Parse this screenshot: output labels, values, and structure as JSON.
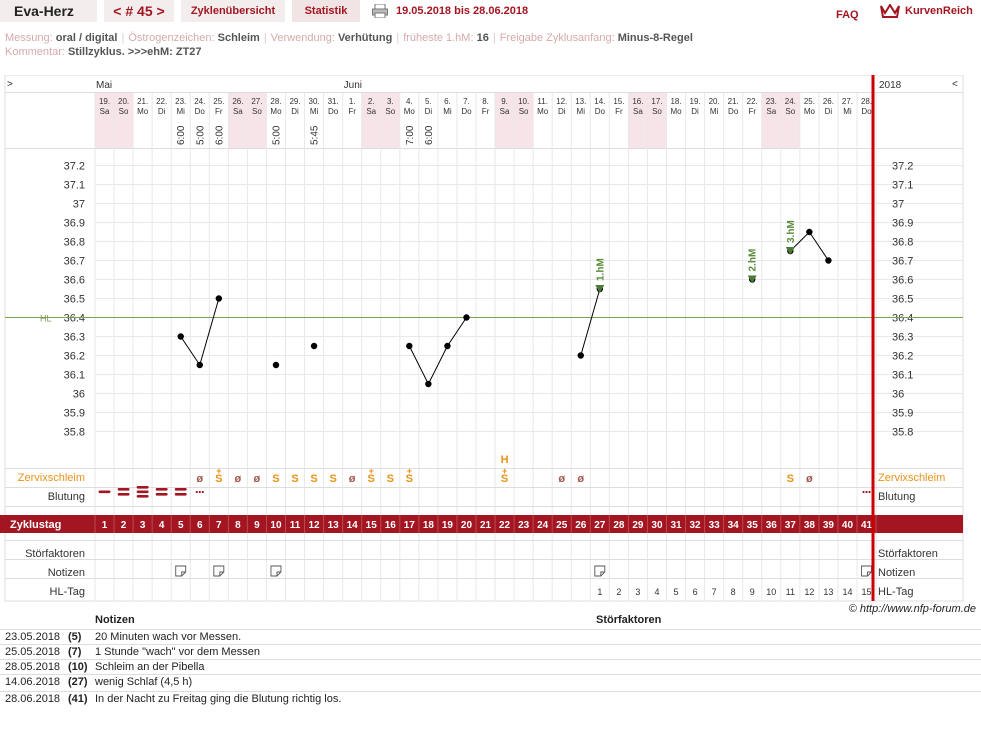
{
  "header": {
    "title": "Eva-Herz",
    "cycle_nav": "< # 45 >",
    "tab_overview": "Zyklenübersicht",
    "tab_stats": "Statistik",
    "range": "19.05.2018 bis 28.06.2018",
    "faq": "FAQ",
    "brand": "KurvenReich"
  },
  "meta": {
    "row1": [
      {
        "label": "Messung:",
        "value": "oral / digital"
      },
      {
        "label": "Östrogenzeichen:",
        "value": "Schleim"
      },
      {
        "label": "Verwendung:",
        "value": "Verhütung"
      },
      {
        "label": "früheste 1.hM:",
        "value": "16"
      },
      {
        "label": "Freigabe Zyklusanfang:",
        "value": "Minus-8-Regel"
      }
    ],
    "row2": [
      {
        "label": "Kommentar:",
        "value": "Stillzyklus.  >>>ehM: ZT27"
      }
    ]
  },
  "colors": {
    "accent": "#a31621",
    "weekend": "#f7e4e8",
    "hl_line": "#7aa34e",
    "mucus": "#e8921a",
    "mucus_dry": "#a2564c",
    "grid": "#e8e8e8"
  },
  "chart_data": {
    "type": "line",
    "months": [
      {
        "label": "Mai",
        "day_index": 0
      },
      {
        "label": "Juni",
        "day_index": 13
      }
    ],
    "year_label": "2018",
    "nav_left": ">",
    "nav_right": "<",
    "days": [
      {
        "d": "19.",
        "w": "Sa"
      },
      {
        "d": "20.",
        "w": "So"
      },
      {
        "d": "21.",
        "w": "Mo"
      },
      {
        "d": "22.",
        "w": "Di"
      },
      {
        "d": "23.",
        "w": "Mi"
      },
      {
        "d": "24.",
        "w": "Do"
      },
      {
        "d": "25.",
        "w": "Fr"
      },
      {
        "d": "26.",
        "w": "Sa"
      },
      {
        "d": "27.",
        "w": "So"
      },
      {
        "d": "28.",
        "w": "Mo"
      },
      {
        "d": "29.",
        "w": "Di"
      },
      {
        "d": "30.",
        "w": "Mi"
      },
      {
        "d": "31.",
        "w": "Do"
      },
      {
        "d": "1.",
        "w": "Fr"
      },
      {
        "d": "2.",
        "w": "Sa"
      },
      {
        "d": "3.",
        "w": "So"
      },
      {
        "d": "4.",
        "w": "Mo"
      },
      {
        "d": "5.",
        "w": "Di"
      },
      {
        "d": "6.",
        "w": "Mi"
      },
      {
        "d": "7.",
        "w": "Do"
      },
      {
        "d": "8.",
        "w": "Fr"
      },
      {
        "d": "9.",
        "w": "Sa"
      },
      {
        "d": "10.",
        "w": "So"
      },
      {
        "d": "11.",
        "w": "Mo"
      },
      {
        "d": "12.",
        "w": "Di"
      },
      {
        "d": "13.",
        "w": "Mi"
      },
      {
        "d": "14.",
        "w": "Do"
      },
      {
        "d": "15.",
        "w": "Fr"
      },
      {
        "d": "16.",
        "w": "Sa"
      },
      {
        "d": "17.",
        "w": "So"
      },
      {
        "d": "18.",
        "w": "Mo"
      },
      {
        "d": "19.",
        "w": "Di"
      },
      {
        "d": "20.",
        "w": "Mi"
      },
      {
        "d": "21.",
        "w": "Do"
      },
      {
        "d": "22.",
        "w": "Fr"
      },
      {
        "d": "23.",
        "w": "Sa"
      },
      {
        "d": "24.",
        "w": "So"
      },
      {
        "d": "25.",
        "w": "Mo"
      },
      {
        "d": "26.",
        "w": "Di"
      },
      {
        "d": "27.",
        "w": "Mi"
      },
      {
        "d": "28.",
        "w": "Do"
      }
    ],
    "times": {
      "5": "6:00",
      "6": "5:00",
      "7": "6:00",
      "10": "5:00",
      "12": "5:45",
      "17": "7:00",
      "18": "6:00"
    },
    "y_ticks": [
      37.2,
      37.1,
      37,
      36.9,
      36.8,
      36.7,
      36.6,
      36.5,
      36.4,
      36.3,
      36.2,
      36.1,
      36,
      35.9,
      35.8
    ],
    "ylim": [
      35.7,
      37.3
    ],
    "hl": {
      "label": "HL",
      "value": 36.4
    },
    "temps": [
      {
        "day": 5,
        "temp": 36.3
      },
      {
        "day": 6,
        "temp": 36.15
      },
      {
        "day": 7,
        "temp": 36.5
      },
      {
        "day": 10,
        "temp": 36.15
      },
      {
        "day": 12,
        "temp": 36.25
      },
      {
        "day": 17,
        "temp": 36.25
      },
      {
        "day": 18,
        "temp": 36.05
      },
      {
        "day": 19,
        "temp": 36.25
      },
      {
        "day": 20,
        "temp": 36.4
      },
      {
        "day": 26,
        "temp": 36.2
      },
      {
        "day": 27,
        "temp": 36.55
      },
      {
        "day": 35,
        "temp": 36.6
      },
      {
        "day": 37,
        "temp": 36.75
      },
      {
        "day": 38,
        "temp": 36.85
      },
      {
        "day": 39,
        "temp": 36.7
      }
    ],
    "segments": [
      [
        5,
        6,
        7
      ],
      [
        17,
        18,
        19,
        20
      ],
      [
        26,
        27
      ],
      [
        37,
        38,
        39
      ]
    ],
    "markers": [
      {
        "day": 27,
        "temp": 36.55,
        "label": "1.hM"
      },
      {
        "day": 35,
        "temp": 36.6,
        "label": "2.hM"
      },
      {
        "day": 37,
        "temp": 36.75,
        "label": "3.hM"
      }
    ],
    "mucus_label": "Zervixschleim",
    "mucus": [
      {
        "day": 6,
        "s": "ø"
      },
      {
        "day": 7,
        "s": "S+"
      },
      {
        "day": 8,
        "s": "ø"
      },
      {
        "day": 9,
        "s": "ø"
      },
      {
        "day": 10,
        "s": "S"
      },
      {
        "day": 11,
        "s": "S"
      },
      {
        "day": 12,
        "s": "S"
      },
      {
        "day": 13,
        "s": "S"
      },
      {
        "day": 14,
        "s": "ø"
      },
      {
        "day": 15,
        "s": "S+"
      },
      {
        "day": 16,
        "s": "S"
      },
      {
        "day": 17,
        "s": "S+"
      },
      {
        "day": 22,
        "s": "S+"
      },
      {
        "day": 25,
        "s": "ø"
      },
      {
        "day": 26,
        "s": "ø"
      },
      {
        "day": 37,
        "s": "S"
      },
      {
        "day": 38,
        "s": "ø"
      }
    ],
    "h_marker": {
      "day": 22,
      "label": "H"
    },
    "bleeding_label": "Blutung",
    "bleeding": [
      {
        "day": 1,
        "level": 1
      },
      {
        "day": 2,
        "level": 2
      },
      {
        "day": 3,
        "level": 3
      },
      {
        "day": 4,
        "level": 2
      },
      {
        "day": 5,
        "level": 2
      },
      {
        "day": 6,
        "level": 0
      },
      {
        "day": 41,
        "level": 0
      }
    ],
    "cycle_label": "Zyklustag",
    "cycle_days": [
      "1",
      "2",
      "3",
      "4",
      "5",
      "6",
      "7",
      "8",
      "9",
      "10",
      "11",
      "12",
      "13",
      "14",
      "15",
      "16",
      "17",
      "18",
      "19",
      "20",
      "21",
      "22",
      "23",
      "24",
      "25",
      "26",
      "27",
      "28",
      "29",
      "30",
      "31",
      "32",
      "33",
      "34",
      "35",
      "36",
      "37",
      "38",
      "39",
      "40",
      "41"
    ],
    "disturb_label": "Störfaktoren",
    "notes_label": "Notizen",
    "notes_days": [
      5,
      7,
      10,
      27,
      41
    ],
    "hl_day_label": "HL-Tag",
    "hl_days": [
      {
        "day": 27,
        "n": "1"
      },
      {
        "day": 28,
        "n": "2"
      },
      {
        "day": 29,
        "n": "3"
      },
      {
        "day": 30,
        "n": "4"
      },
      {
        "day": 31,
        "n": "5"
      },
      {
        "day": 32,
        "n": "6"
      },
      {
        "day": 33,
        "n": "7"
      },
      {
        "day": 34,
        "n": "8"
      },
      {
        "day": 35,
        "n": "9"
      },
      {
        "day": 36,
        "n": "10"
      },
      {
        "day": 37,
        "n": "11"
      },
      {
        "day": 38,
        "n": "12"
      },
      {
        "day": 39,
        "n": "13"
      },
      {
        "day": 40,
        "n": "14"
      },
      {
        "day": 41,
        "n": "15"
      }
    ]
  },
  "copyright": "© http://www.nfp-forum.de",
  "notes_table": {
    "col_notes": "Notizen",
    "col_disturb": "Störfaktoren",
    "rows": [
      {
        "date": "23.05.2018",
        "cd": "(5)",
        "text": "20 Minuten wach vor Messen."
      },
      {
        "date": "25.05.2018",
        "cd": "(7)",
        "text": "1 Stunde \"wach\" vor dem Messen"
      },
      {
        "date": "28.05.2018",
        "cd": "(10)",
        "text": "Schleim an der Pibella"
      },
      {
        "date": "14.06.2018",
        "cd": "(27)",
        "text": "wenig Schlaf (4,5 h)"
      },
      {
        "date": "28.06.2018",
        "cd": "(41)",
        "text": "In der Nacht zu Freitag ging die Blutung richtig los."
      }
    ]
  }
}
